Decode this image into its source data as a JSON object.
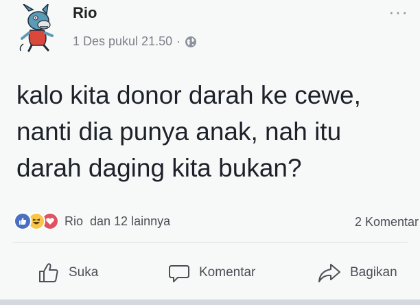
{
  "post": {
    "author": "Rio",
    "timestamp": "1 Des pukul 21.50",
    "separator": "·",
    "privacy_icon": "globe-icon",
    "more_icon": "more-options-icon",
    "more_glyph": "···",
    "avatar_icon": "cartoon-donkey-avatar",
    "content_lines": [
      "kalo kita donor darah ke cewe,",
      "nanti dia punya anak, nah itu",
      "darah daging kita bukan?"
    ]
  },
  "reactions": {
    "icons": [
      "like-reaction-icon",
      "haha-reaction-icon",
      "love-reaction-icon"
    ],
    "name": "Rio",
    "others": "dan 12 lainnya",
    "comments_count": "2 Komentar"
  },
  "actions": {
    "like_label": "Suka",
    "comment_label": "Komentar",
    "share_label": "Bagikan"
  },
  "colors": {
    "like_blue": "#4a6fc1",
    "haha_yellow": "#f7c64a",
    "love_red": "#e0525f",
    "text_primary": "#1d2129",
    "text_secondary": "#7d8289"
  }
}
